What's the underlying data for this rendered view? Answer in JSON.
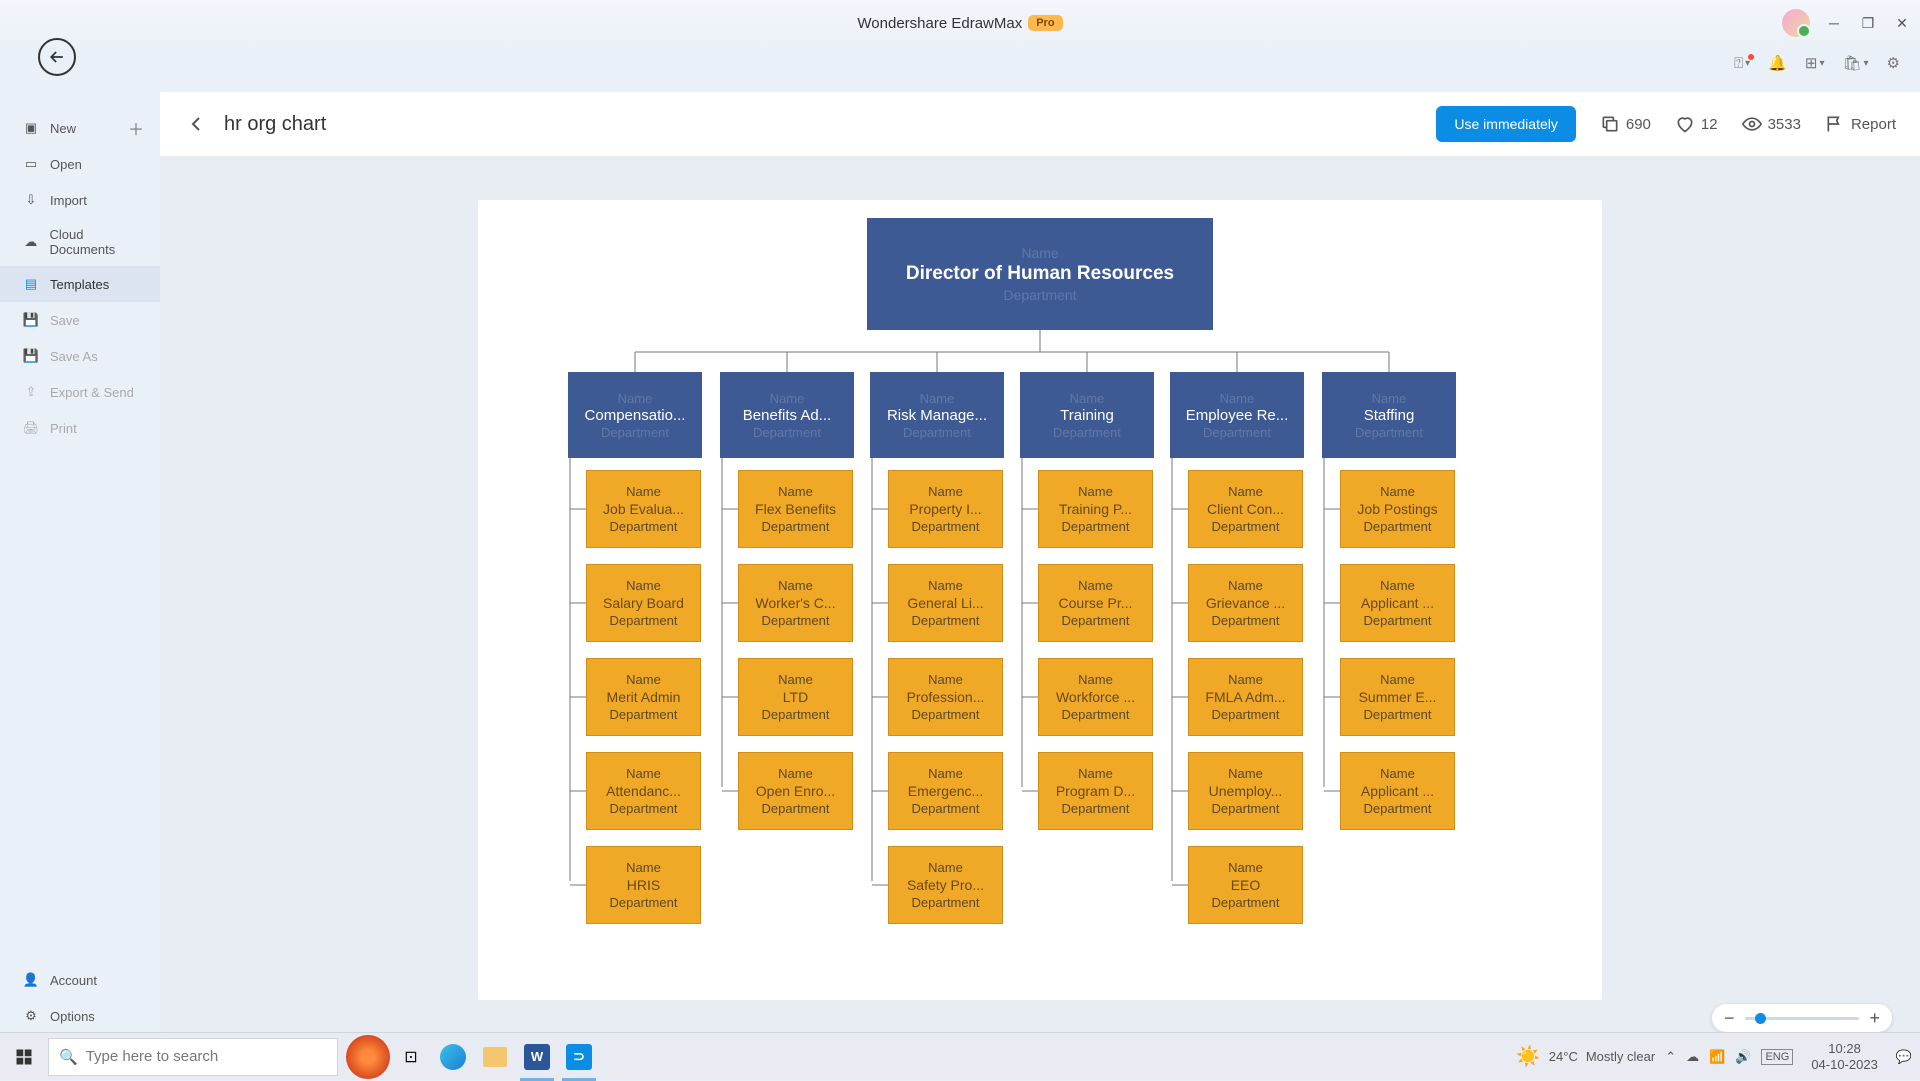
{
  "titlebar": {
    "app": "Wondershare EdrawMax",
    "badge": "Pro"
  },
  "sidebar": {
    "items": [
      {
        "label": "New"
      },
      {
        "label": "Open"
      },
      {
        "label": "Import"
      },
      {
        "label": "Cloud Documents"
      },
      {
        "label": "Templates"
      },
      {
        "label": "Save"
      },
      {
        "label": "Save As"
      },
      {
        "label": "Export & Send"
      },
      {
        "label": "Print"
      }
    ],
    "bottom": [
      {
        "label": "Account"
      },
      {
        "label": "Options"
      }
    ]
  },
  "header": {
    "title": "hr org chart",
    "use_btn": "Use immediately",
    "copies": "690",
    "likes": "12",
    "views": "3533",
    "report": "Report"
  },
  "chart": {
    "faint_name": "Name",
    "faint_dept": "Department",
    "top": "Director of Human Resources",
    "cols": [
      {
        "title": "Compensatio...",
        "items": [
          "Job Evalua...",
          "Salary Board",
          "Merit Admin",
          "Attendanc...",
          "HRIS"
        ]
      },
      {
        "title": "Benefits Ad...",
        "items": [
          "Flex Benefits",
          "Worker's C...",
          "LTD",
          "Open Enro..."
        ]
      },
      {
        "title": "Risk Manage...",
        "items": [
          "Property I...",
          "General Li...",
          "Profession...",
          "Emergenc...",
          "Safety Pro..."
        ]
      },
      {
        "title": "Training",
        "items": [
          "Training P...",
          "Course Pr...",
          "Workforce ...",
          "Program D..."
        ]
      },
      {
        "title": "Employee Re...",
        "items": [
          "Client Con...",
          "Grievance ...",
          "FMLA Adm...",
          "Unemploy...",
          "EEO"
        ]
      },
      {
        "title": "Staffing",
        "items": [
          "Job Postings",
          "Applicant ...",
          "Summer E...",
          "Applicant ..."
        ]
      }
    ]
  },
  "taskbar": {
    "search_placeholder": "Type here to search",
    "weather_temp": "24°C",
    "weather_desc": "Mostly clear",
    "time": "10:28",
    "date": "04-10-2023"
  }
}
